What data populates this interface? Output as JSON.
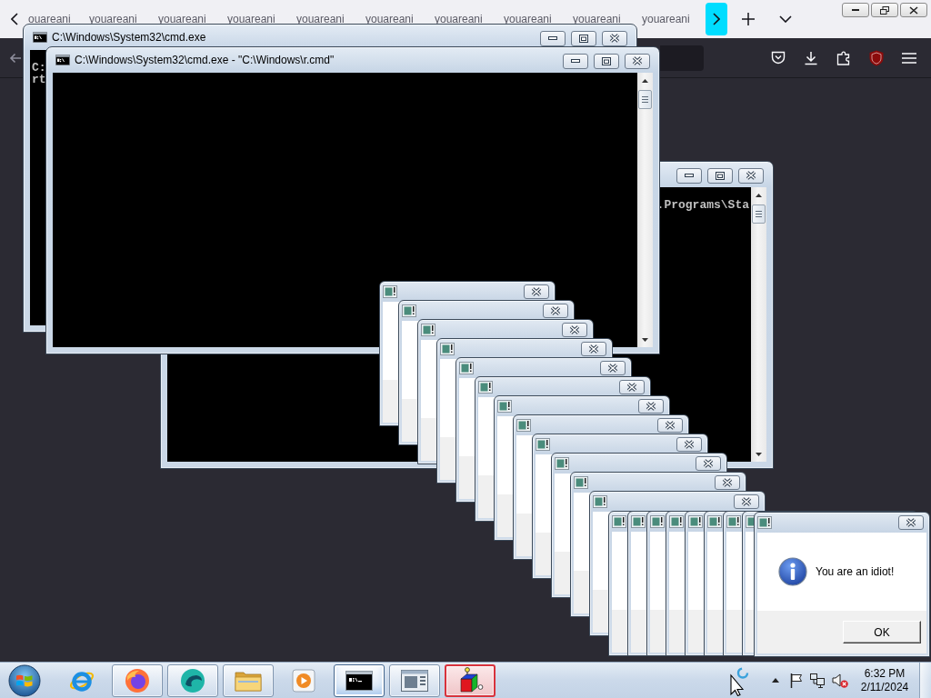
{
  "browser": {
    "tabs": [
      {
        "label": "ouareani",
        "selected": false
      },
      {
        "label": "youareani",
        "selected": false
      },
      {
        "label": "youareani",
        "selected": false
      },
      {
        "label": "youareani",
        "selected": false
      },
      {
        "label": "youareani",
        "selected": false
      },
      {
        "label": "youareani",
        "selected": false
      },
      {
        "label": "youareani",
        "selected": false
      },
      {
        "label": "youareani",
        "selected": false
      },
      {
        "label": "youareani",
        "selected": false
      },
      {
        "label": "youareani",
        "selected": false
      }
    ]
  },
  "consoles": [
    {
      "title": "C:\\Windows\\System32\\cmd.exe",
      "lines": [
        "C:",
        "rt"
      ]
    },
    {
      "title": "C:\\Windows\\System32\\cmd.exe - \"C:\\Windows\\r.cmd\""
    },
    {
      "lines": [
        ".Programs\\Sta"
      ]
    }
  ],
  "popups": [
    {
      "kind": "cascade"
    },
    {
      "kind": "cascade"
    },
    {
      "kind": "cascade"
    },
    {
      "kind": "cascade"
    },
    {
      "kind": "cascade"
    },
    {
      "kind": "cascade"
    },
    {
      "kind": "cascade"
    },
    {
      "kind": "cascade"
    },
    {
      "kind": "cascade"
    },
    {
      "kind": "cascade"
    },
    {
      "kind": "cascade"
    },
    {
      "kind": "cascade"
    },
    {
      "kind": "row"
    },
    {
      "kind": "row"
    },
    {
      "kind": "row"
    },
    {
      "kind": "row"
    },
    {
      "kind": "row"
    },
    {
      "kind": "row"
    },
    {
      "kind": "row"
    },
    {
      "kind": "row"
    },
    {
      "kind": "message",
      "text": "You are an idiot!",
      "button": "OK"
    }
  ],
  "taskbar": {
    "buttons": [
      {
        "kind": "orbit",
        "running": false,
        "selected": false,
        "flashing": false
      },
      {
        "kind": "flame",
        "running": true,
        "selected": false,
        "flashing": false
      },
      {
        "kind": "swirl",
        "running": true,
        "selected": false,
        "flashing": false
      },
      {
        "kind": "folder",
        "running": true,
        "selected": false,
        "flashing": false
      },
      {
        "kind": "play",
        "running": false,
        "selected": false,
        "flashing": false
      },
      {
        "kind": "console",
        "running": true,
        "selected": true,
        "flashing": false
      },
      {
        "kind": "window",
        "running": true,
        "selected": false,
        "flashing": false
      },
      {
        "kind": "cube",
        "running": true,
        "selected": false,
        "flashing": true
      }
    ],
    "tray": {
      "volume": {
        "muted": true
      },
      "time": "6:32 PM",
      "date": "2/11/2024"
    }
  }
}
